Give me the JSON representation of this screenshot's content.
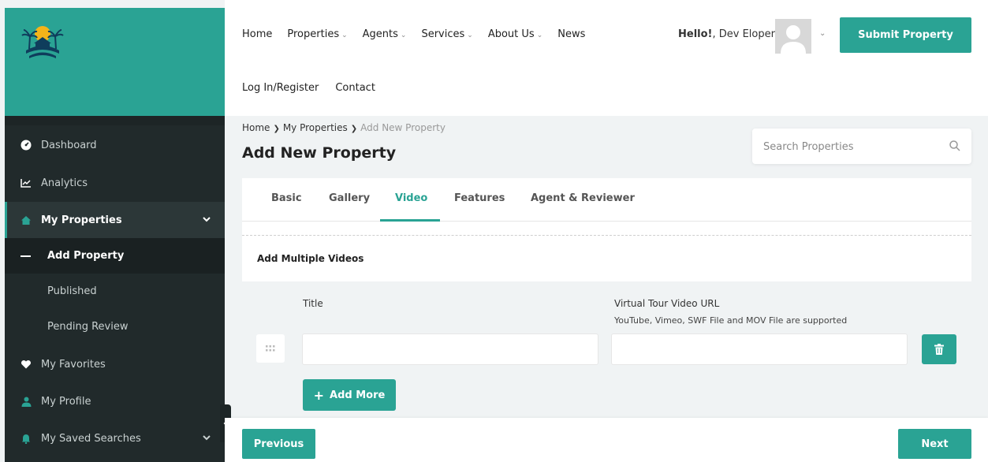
{
  "colors": {
    "accent": "#2aa394",
    "sidebar_bg": "#212a2b",
    "page_bg": "#f0f3f4"
  },
  "header": {
    "menu": [
      {
        "label": "Home",
        "dropdown": false
      },
      {
        "label": "Properties",
        "dropdown": true
      },
      {
        "label": "Agents",
        "dropdown": true
      },
      {
        "label": "Services",
        "dropdown": true
      },
      {
        "label": "About Us",
        "dropdown": true
      },
      {
        "label": "News",
        "dropdown": false
      }
    ],
    "menu_row2": [
      "Log In/Register",
      "Contact"
    ],
    "greeting_bold": "Hello!",
    "greeting_name": ", Dev Eloper",
    "submit_label": "Submit Property"
  },
  "sidebar": {
    "items": [
      {
        "label": "Dashboard",
        "icon": "dashboard-icon"
      },
      {
        "label": "Analytics",
        "icon": "chart-icon"
      },
      {
        "label": "My Properties",
        "icon": "home-icon",
        "active": true
      },
      {
        "label": "My Favorites",
        "icon": "heart-icon"
      },
      {
        "label": "My Profile",
        "icon": "user-icon"
      },
      {
        "label": "My Saved Searches",
        "icon": "bell-icon"
      }
    ],
    "sub_items": [
      "Add Property",
      "Published",
      "Pending Review"
    ]
  },
  "breadcrumb": [
    "Home",
    "My Properties",
    "Add New Property"
  ],
  "page_title": "Add New Property",
  "search": {
    "placeholder": "Search Properties"
  },
  "tabs": [
    "Basic",
    "Gallery",
    "Video",
    "Features",
    "Agent & Reviewer"
  ],
  "active_tab": "Video",
  "section": {
    "title": "Add Multiple Videos",
    "title_label": "Title",
    "url_label": "Virtual Tour Video URL",
    "url_hint": "YouTube, Vimeo, SWF File and MOV File are supported",
    "title_value": "",
    "url_value": "",
    "add_more_label": "Add More"
  },
  "footer": {
    "prev_label": "Previous",
    "next_label": "Next"
  }
}
